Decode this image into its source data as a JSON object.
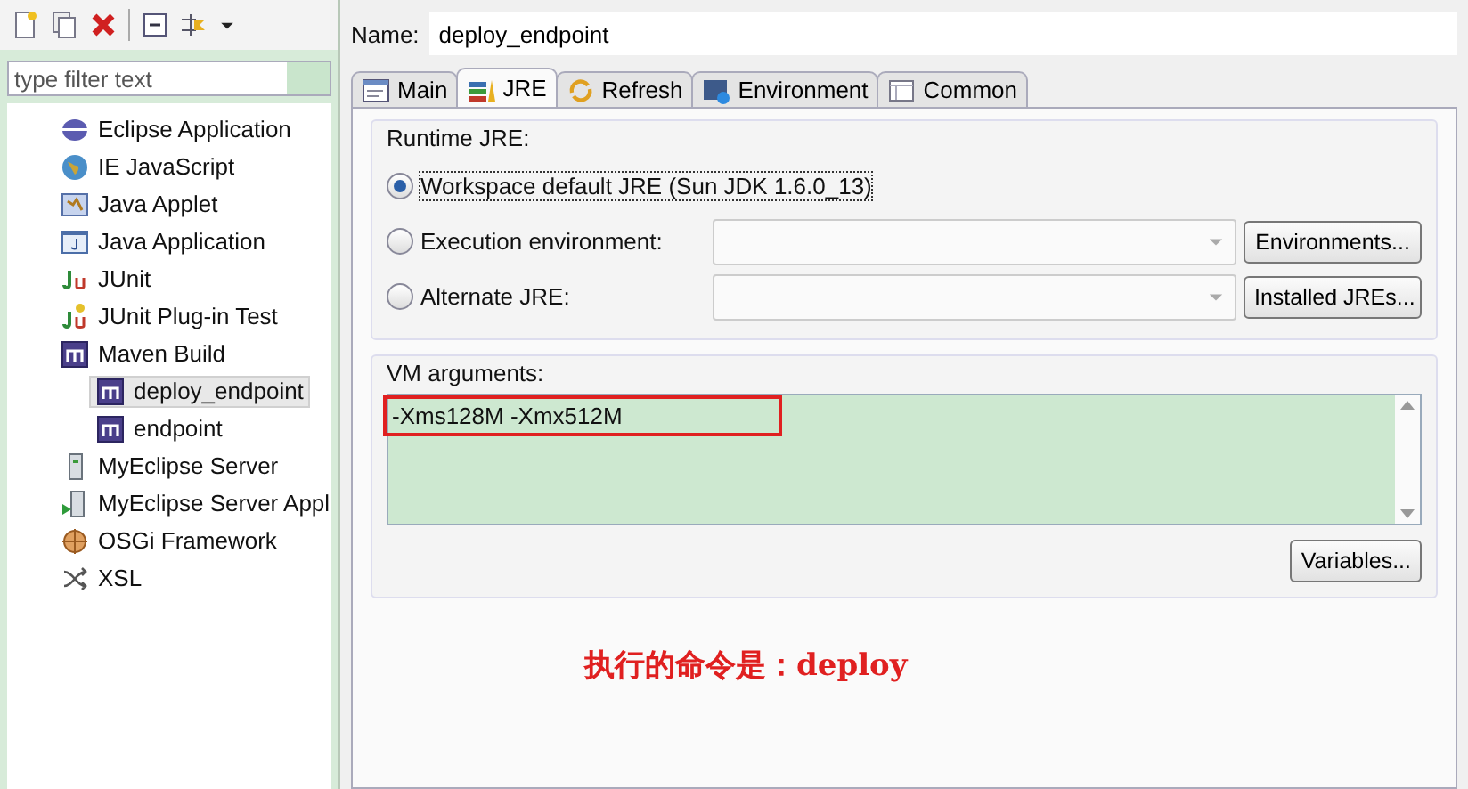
{
  "toolbar": {
    "has_menu": true
  },
  "filter": {
    "placeholder": "type filter text"
  },
  "tree": [
    {
      "label": "Eclipse Application",
      "kind": "eclipse",
      "selected": false
    },
    {
      "label": "IE JavaScript",
      "kind": "globe",
      "selected": false
    },
    {
      "label": "Java Applet",
      "kind": "applet",
      "selected": false
    },
    {
      "label": "Java Application",
      "kind": "java",
      "selected": false
    },
    {
      "label": "JUnit",
      "kind": "junit",
      "selected": false
    },
    {
      "label": "JUnit Plug-in Test",
      "kind": "plugin-test",
      "selected": false
    },
    {
      "label": "Maven Build",
      "kind": "maven",
      "selected": false,
      "children": [
        {
          "label": "deploy_endpoint",
          "kind": "maven",
          "selected": true
        },
        {
          "label": "endpoint",
          "kind": "maven",
          "selected": false
        }
      ]
    },
    {
      "label": "MyEclipse Server",
      "kind": "server",
      "selected": false
    },
    {
      "label": "MyEclipse Server Appl",
      "kind": "server-app",
      "selected": false
    },
    {
      "label": "OSGi Framework",
      "kind": "osgi",
      "selected": false
    },
    {
      "label": "XSL",
      "kind": "xsl",
      "selected": false
    }
  ],
  "name": {
    "label": "Name:",
    "value": "deploy_endpoint"
  },
  "tabs": [
    {
      "label": "Main",
      "kind": "main",
      "selected": false
    },
    {
      "label": "JRE",
      "kind": "jre",
      "selected": true
    },
    {
      "label": "Refresh",
      "kind": "refresh",
      "selected": false
    },
    {
      "label": "Environment",
      "kind": "environment",
      "selected": false
    },
    {
      "label": "Common",
      "kind": "common",
      "selected": false
    }
  ],
  "runtime_jre": {
    "title": "Runtime JRE:",
    "options": [
      {
        "label": "Workspace default JRE (Sun JDK 1.6.0_13)",
        "selected": true
      },
      {
        "label": "Execution environment:",
        "selected": false,
        "button": "Environments..."
      },
      {
        "label": "Alternate JRE:",
        "selected": false,
        "button": "Installed JREs..."
      }
    ]
  },
  "vm_arguments": {
    "title": "VM arguments:",
    "value": "-Xms128M -Xmx512M",
    "button": "Variables..."
  },
  "annotation": {
    "text": "执行的命令是：deploy",
    "highlighted": true
  }
}
